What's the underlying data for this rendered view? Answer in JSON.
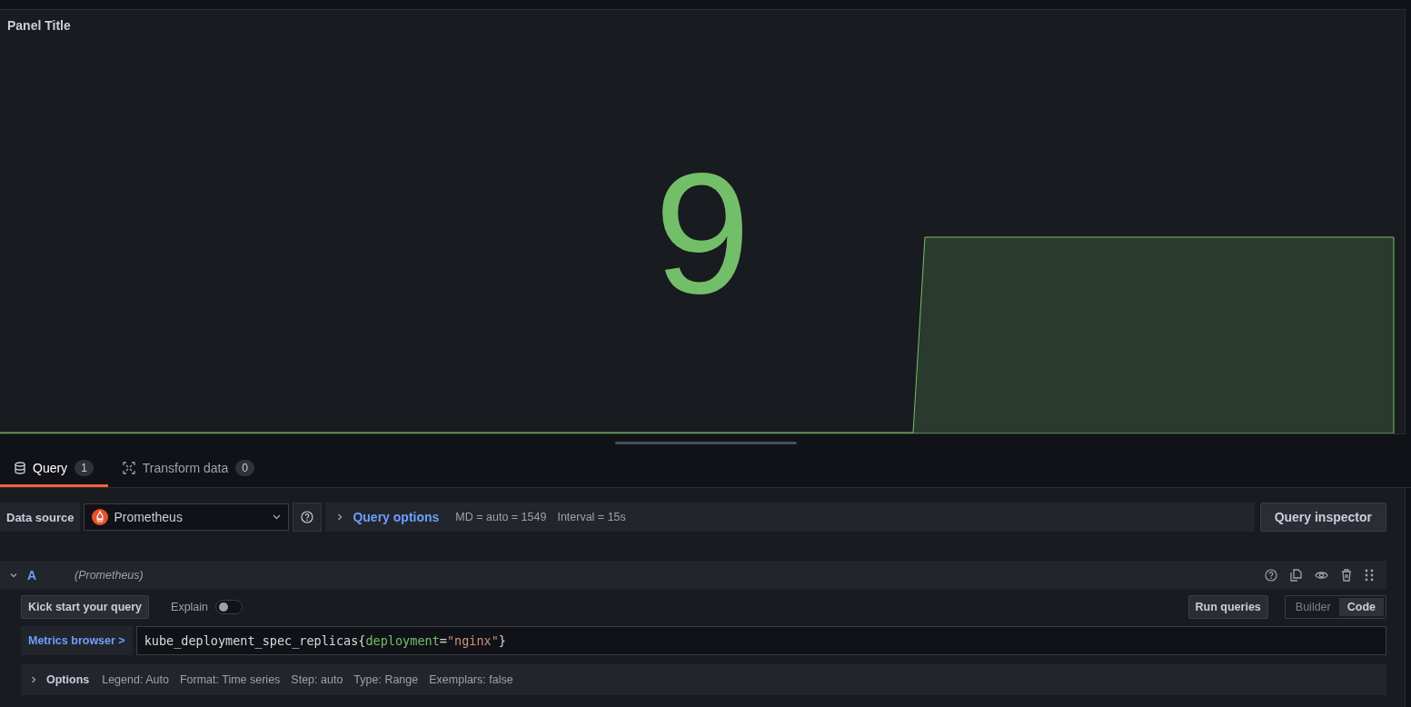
{
  "panel": {
    "title": "Panel Title",
    "stat_value": "9"
  },
  "tabs": [
    {
      "label": "Query",
      "count": "1",
      "selected": true,
      "kind": "query"
    },
    {
      "label": "Transform data",
      "count": "0",
      "selected": false,
      "kind": "transform"
    }
  ],
  "data_source": {
    "label": "Data source",
    "value": "Prometheus"
  },
  "query_options": {
    "label": "Query options",
    "md": "MD = auto = 1549",
    "interval": "Interval = 15s",
    "expanded": false
  },
  "query_inspector": "Query inspector",
  "query": {
    "ref_id": "A",
    "datasource": "(Prometheus)",
    "expanded": true,
    "kick_start": "Kick start your query",
    "explain": {
      "label": "Explain",
      "on": false
    },
    "run_queries": "Run queries",
    "modes": [
      {
        "label": "Builder",
        "selected": false
      },
      {
        "label": "Code",
        "selected": true
      }
    ],
    "metrics_browser": "Metrics browser >",
    "code": [
      {
        "kind": "metric",
        "text": "kube_deployment_spec_replicas"
      },
      {
        "kind": "punct",
        "text": "{"
      },
      {
        "kind": "label",
        "text": "deployment"
      },
      {
        "kind": "punct",
        "text": "="
      },
      {
        "kind": "string",
        "text": "\"nginx\""
      },
      {
        "kind": "punct",
        "text": "}"
      }
    ],
    "options": {
      "label": "Options",
      "expanded": false,
      "items": [
        "Legend: Auto",
        "Format: Time series",
        "Step: auto",
        "Type: Range",
        "Exemplars: false"
      ]
    }
  }
}
